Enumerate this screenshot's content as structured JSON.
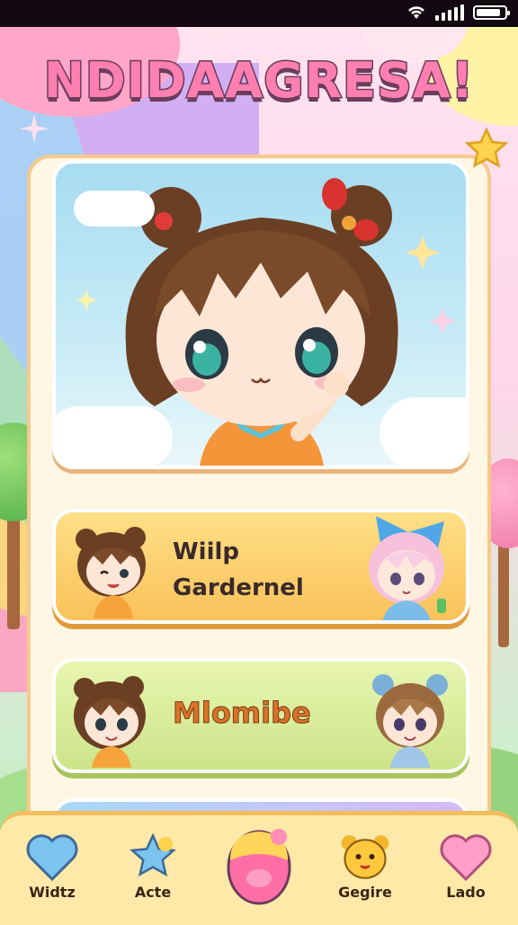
{
  "title": "NDIDAAGRESA!",
  "modes": [
    {
      "label_line1": "Wiilp",
      "label_line2": "Gardernel"
    },
    {
      "label": "Mlomibe"
    }
  ],
  "nav": [
    {
      "label": "Widtz",
      "icon": "heart-icon"
    },
    {
      "label": "Acte",
      "icon": "star-icon"
    },
    {
      "label": "",
      "icon": "egg-icon"
    },
    {
      "label": "Gegire",
      "icon": "bear-icon"
    },
    {
      "label": "Lado",
      "icon": "heart-icon"
    }
  ],
  "colors": {
    "accent": "#ff7fb0",
    "card_border": "#f6c98e",
    "nav_bg": "#ffe9a8"
  }
}
